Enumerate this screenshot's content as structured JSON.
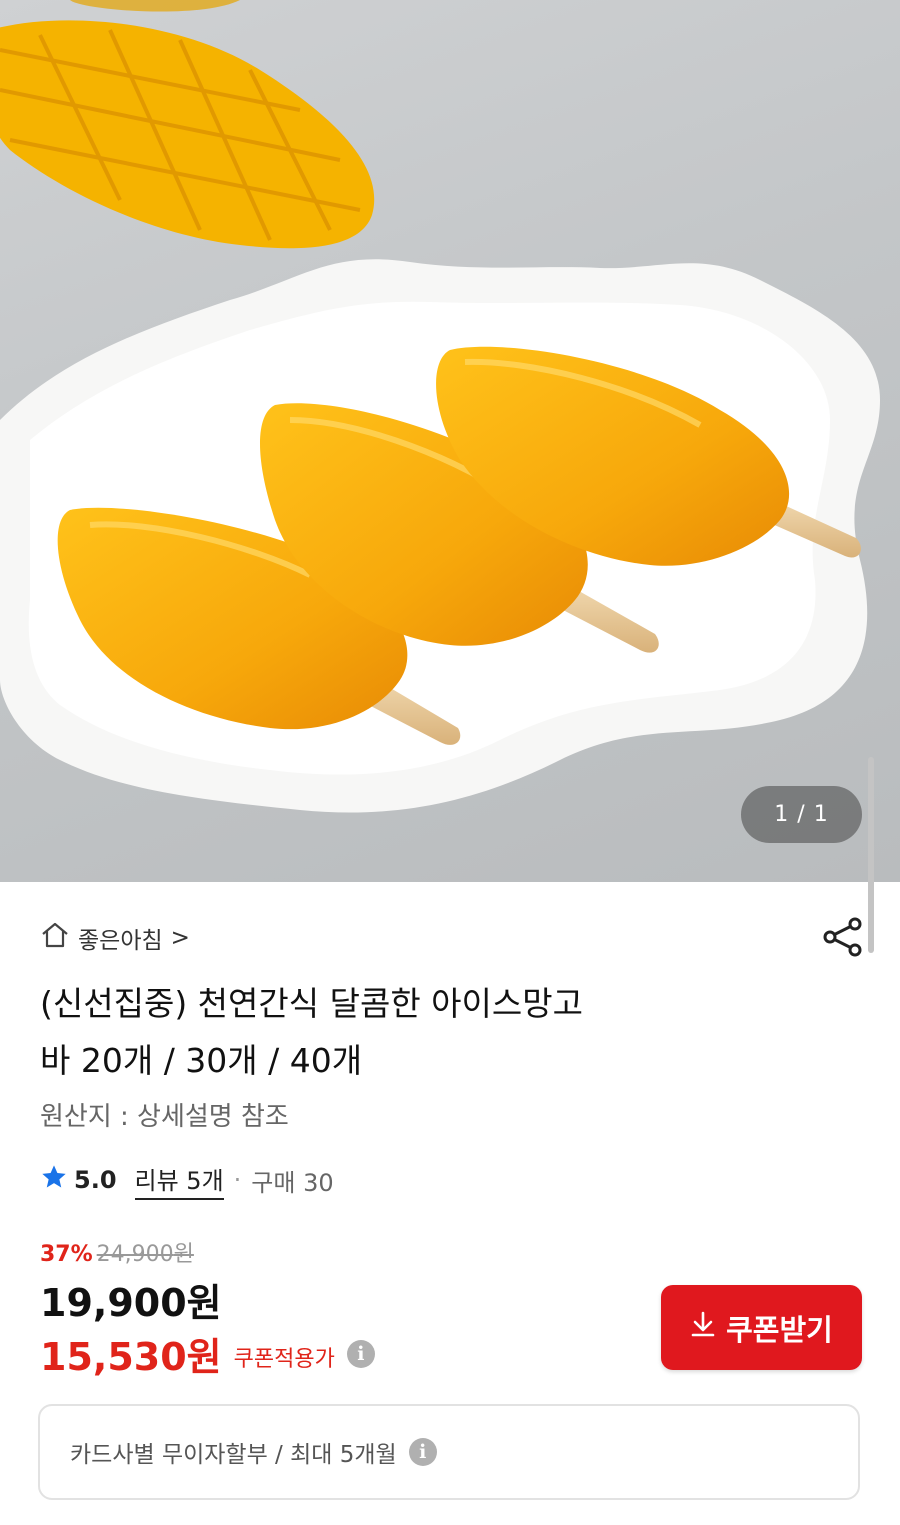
{
  "gallery": {
    "counter": "1 / 1",
    "image_alt": "mango ice bars on a white plate"
  },
  "store": {
    "name": "좋은아침",
    "icon": "home-icon",
    "chevron": ">"
  },
  "product": {
    "title_line1": "(신선집중) 천연간식 달콤한 아이스망고",
    "title_line2": "바 20개 / 30개 / 40개",
    "origin": "원산지 : 상세설명 참조"
  },
  "rating": {
    "score": "5.0",
    "reviews": "리뷰 5개",
    "separator": "·",
    "purchases": "구매 30",
    "star_color": "#1a73e8"
  },
  "price": {
    "discount_rate": "37%",
    "original": "24,900",
    "original_unit": "원",
    "sale": "19,900원",
    "coupon_price": "15,530원",
    "coupon_label": "쿠폰적용가",
    "info_glyph": "i"
  },
  "coupon_button": {
    "label": "쿠폰받기",
    "icon": "download-arrow-icon",
    "color": "#e0181e"
  },
  "installment": {
    "text": "카드사별 무이자할부 / 최대 5개월"
  }
}
